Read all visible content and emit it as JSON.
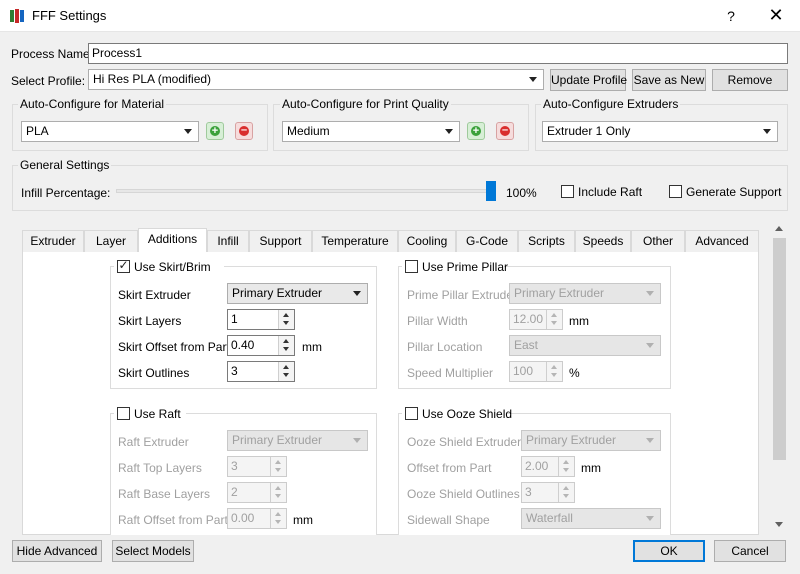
{
  "window": {
    "title": "FFF Settings",
    "help_glyph": "?",
    "close_glyph": "✕",
    "icons": {
      "app": "app-logo-icon",
      "help": "question-mark",
      "close": "close-x"
    }
  },
  "process": {
    "label": "Process Name:",
    "value": "Process1"
  },
  "profile": {
    "label": "Select Profile:",
    "selected": "Hi Res PLA (modified)",
    "update_button": "Update Profile",
    "save_as_new_button": "Save as New",
    "remove_button": "Remove"
  },
  "auto_configure": {
    "material": {
      "title": "Auto-Configure for Material",
      "selected": "PLA"
    },
    "quality": {
      "title": "Auto-Configure for Print Quality",
      "selected": "Medium"
    },
    "extruders": {
      "title": "Auto-Configure Extruders",
      "selected": "Extruder 1 Only"
    },
    "icons": {
      "add": "plus-circle-green",
      "remove": "minus-circle-red"
    }
  },
  "general": {
    "title": "General Settings",
    "infill_label": "Infill Percentage:",
    "infill_value": 100,
    "infill_text": "100%",
    "include_raft": {
      "label": "Include Raft",
      "checked": false
    },
    "generate_support": {
      "label": "Generate Support",
      "checked": false
    }
  },
  "tabs": [
    {
      "label": "Extruder",
      "active": false
    },
    {
      "label": "Layer",
      "active": false
    },
    {
      "label": "Additions",
      "active": true
    },
    {
      "label": "Infill",
      "active": false
    },
    {
      "label": "Support",
      "active": false
    },
    {
      "label": "Temperature",
      "active": false
    },
    {
      "label": "Cooling",
      "active": false
    },
    {
      "label": "G-Code",
      "active": false
    },
    {
      "label": "Scripts",
      "active": false
    },
    {
      "label": "Speeds",
      "active": false
    },
    {
      "label": "Other",
      "active": false
    },
    {
      "label": "Advanced",
      "active": false
    }
  ],
  "skirt": {
    "title": "Use Skirt/Brim",
    "checked": true,
    "extruder_label": "Skirt Extruder",
    "extruder_value": "Primary Extruder",
    "layers_label": "Skirt Layers",
    "layers_value": "1",
    "offset_label": "Skirt Offset from Part",
    "offset_value": "0.40",
    "offset_unit": "mm",
    "outlines_label": "Skirt Outlines",
    "outlines_value": "3"
  },
  "prime_pillar": {
    "title": "Use Prime Pillar",
    "checked": false,
    "extruder_label": "Prime Pillar Extruder",
    "extruder_value": "Primary Extruder",
    "width_label": "Pillar Width",
    "width_value": "12.00",
    "width_unit": "mm",
    "location_label": "Pillar Location",
    "location_value": "East",
    "speed_label": "Speed Multiplier",
    "speed_value": "100",
    "speed_unit": "%"
  },
  "raft": {
    "title": "Use Raft",
    "checked": false,
    "extruder_label": "Raft Extruder",
    "extruder_value": "Primary Extruder",
    "top_label": "Raft Top Layers",
    "top_value": "3",
    "base_label": "Raft Base Layers",
    "base_value": "2",
    "offset_label": "Raft Offset from Part",
    "offset_value": "0.00",
    "offset_unit": "mm"
  },
  "ooze": {
    "title": "Use Ooze Shield",
    "checked": false,
    "extruder_label": "Ooze Shield Extruder",
    "extruder_value": "Primary Extruder",
    "offset_label": "Offset from Part",
    "offset_value": "2.00",
    "offset_unit": "mm",
    "outlines_label": "Ooze Shield Outlines",
    "outlines_value": "3",
    "sidewall_label": "Sidewall Shape",
    "sidewall_value": "Waterfall"
  },
  "footer": {
    "hide_advanced": "Hide Advanced",
    "select_models": "Select Models",
    "ok": "OK",
    "cancel": "Cancel"
  },
  "colors": {
    "accent": "#0078d7",
    "add_green": "#3aa13a",
    "remove_red": "#d92d2d"
  }
}
